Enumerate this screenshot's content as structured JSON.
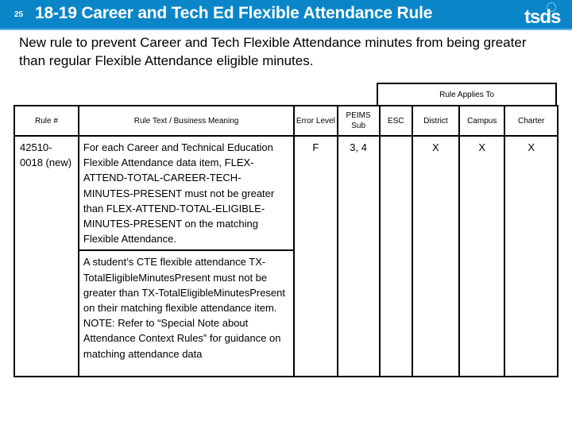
{
  "header": {
    "slide_number": "25",
    "title": "18-19 Career and Tech Ed Flexible Attendance Rule",
    "logo_text": "tsds",
    "background_color": "#0a86c8"
  },
  "intro": "New rule to prevent Career and Tech Flexible Attendance minutes from being greater than regular Flexible Attendance eligible minutes.",
  "table": {
    "group_header": "Rule Applies To",
    "columns": [
      "Rule #",
      "Rule Text / Business Meaning",
      "Error Level",
      "PEIMS Sub",
      "ESC",
      "District",
      "Campus",
      "Charter"
    ],
    "rows": [
      {
        "rule_number": "42510-0018 (new)",
        "rule_text": "For each Career and Technical Education Flexible Attendance data item, FLEX-ATTEND-TOTAL-CAREER-TECH-MINUTES-PRESENT must not be greater than FLEX-ATTEND-TOTAL-ELIGIBLE-MINUTES-PRESENT on the matching Flexible Attendance.",
        "business_meaning": "A student’s CTE flexible attendance TX-TotalEligibleMinutesPresent must not be greater than TX-TotalEligibleMinutesPresent on their matching flexible attendance item. NOTE: Refer to “Special Note about Attendance Context Rules” for guidance on matching attendance data",
        "error_level": "F",
        "peims_sub": "3, 4",
        "esc": "",
        "district": "X",
        "campus": "X",
        "charter": "X"
      }
    ]
  }
}
